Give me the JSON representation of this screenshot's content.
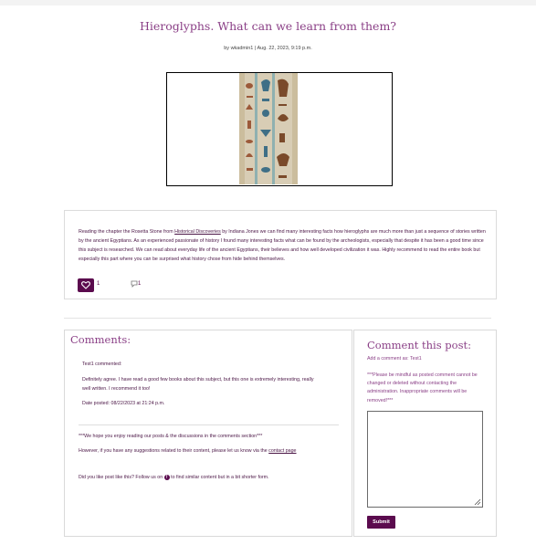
{
  "post": {
    "title": "Hieroglyphs. What can we learn from them?",
    "byline": "by wkadmin1 | Aug. 22, 2023, 9:19 p.m.",
    "body_before_link": "Reading the chapter the Rosetta Stone from ",
    "link_text": "Historical Discoveries",
    "body_after_link": " by Indiana Jones we can find many interesting facts how hieroglyphs are much more than just a sequence of stories written by the ancient Egyptians. As an experienced passionate of history I found many interesting facts what can be found by the archeologists, especially that despite it has been a good time since this subject is researched. We can read about everyday life of the ancient Egyptians, their believes and how well developed civilization it was. Highly recommend to read the entire book but especially this part where you can be surprised what history chose from hide behind themselves.",
    "likes": "1",
    "comment_count": "1",
    "image_icon": "hieroglyphs-image"
  },
  "comments": {
    "heading": "Comments:",
    "items": [
      {
        "author_line": "Test1 commented:",
        "text": "Definitely agree. I have read a good few books about this subject, but this one is extremely interesting, really well written. I recommend it too!",
        "date": "Date posted: 08/22/2023 at 21:24 p.m."
      }
    ],
    "note1": "***We hope you enjoy reading our posts & the discussions in the comments section***",
    "note2_before": "However, if you have any suggestions related to their content, please let us know via the ",
    "note2_link": "contact page",
    "note3_before": "Did you like post like this? Follow us on ",
    "note3_after": " to find similar content but in a bit shorter form."
  },
  "form": {
    "heading": "Comment this post:",
    "add_as": "Add a comment as: Test1",
    "warning": "***Please be mindful as posted comment cannot be changed or deleted without contacting the administration. Inappropriate comments will be removed!***",
    "submit_label": "Submit"
  },
  "colors": {
    "accent": "#5b0b4e",
    "heading": "#8a3f86"
  }
}
